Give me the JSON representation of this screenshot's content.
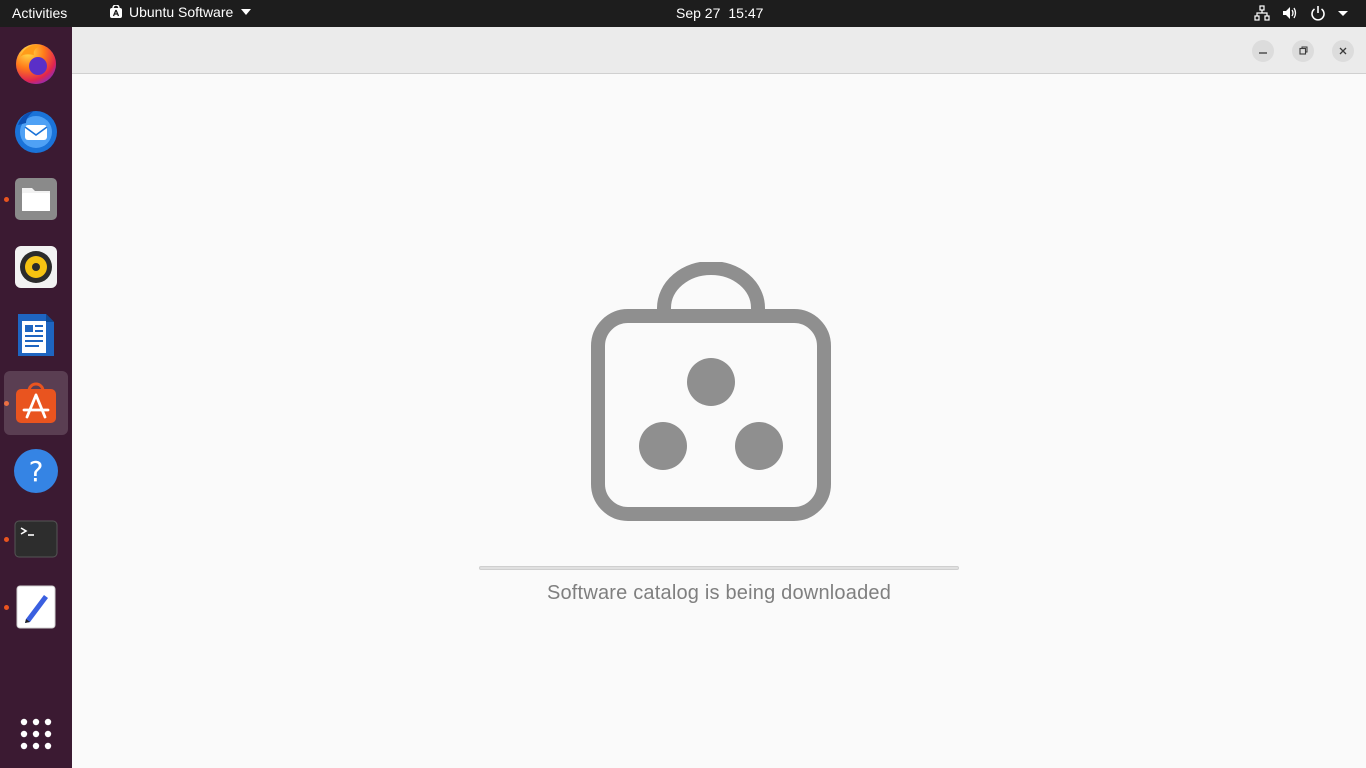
{
  "topbar": {
    "activities_label": "Activities",
    "app_menu_label": "Ubuntu Software",
    "date": "Sep 27",
    "time": "15:47",
    "tray_icons": [
      "network-icon",
      "volume-icon",
      "power-icon",
      "chevron-down-icon"
    ]
  },
  "dock": {
    "items": [
      {
        "name": "firefox",
        "running": false,
        "active": false
      },
      {
        "name": "thunderbird",
        "running": false,
        "active": false
      },
      {
        "name": "files",
        "running": true,
        "active": false
      },
      {
        "name": "rhythmbox",
        "running": false,
        "active": false
      },
      {
        "name": "libreoffice-writer",
        "running": false,
        "active": false
      },
      {
        "name": "ubuntu-software",
        "running": true,
        "active": true
      },
      {
        "name": "help",
        "running": false,
        "active": false
      },
      {
        "name": "terminal",
        "running": true,
        "active": false
      },
      {
        "name": "text-editor",
        "running": true,
        "active": false
      }
    ],
    "show_apps_icon": "grid-icon",
    "accent_color": "#e9541f"
  },
  "window": {
    "controls": [
      "minimize-icon",
      "restore-icon",
      "close-icon"
    ],
    "status_text": "Software catalog is being downloaded",
    "progress_fraction": 0.0,
    "icon_color": "#8f8f8f"
  }
}
